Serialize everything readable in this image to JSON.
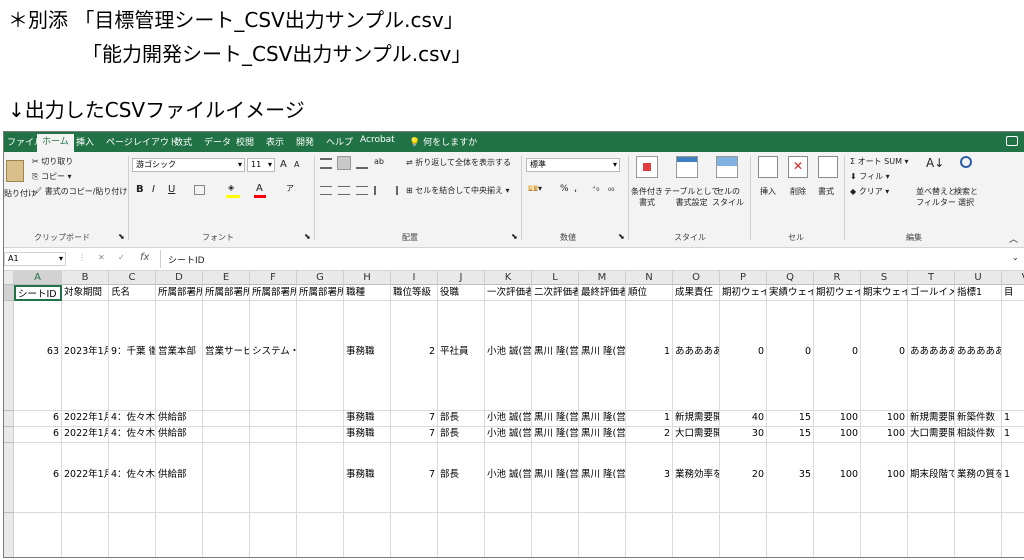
{
  "caption": {
    "line1_prefix": "＊別添",
    "line1_file": "「目標管理シート_CSV出力サンプル.csv」",
    "line2_file": "「能力開発シート_CSV出力サンプル.csv」",
    "line3": "↓出力したCSVファイルイメージ"
  },
  "colors": {
    "excel_green": "#217346",
    "ribbon_bg": "#f3f3f3"
  },
  "menu": {
    "tabs": [
      "ファイル",
      "ホーム",
      "挿入",
      "ページレイアウト",
      "数式",
      "データ",
      "校閲",
      "表示",
      "開発",
      "ヘルプ",
      "Acrobat"
    ],
    "active": "ホーム",
    "search_label": "何をしますか"
  },
  "ribbon": {
    "clipboard": {
      "cut": "切り取り",
      "copy": "コピー",
      "paste": "貼り付け",
      "format_painter": "書式のコピー/貼り付け",
      "group": "クリップボード"
    },
    "font": {
      "name": "游ゴシック",
      "size": "11",
      "grow": "A",
      "shrink": "A",
      "bold": "B",
      "italic": "I",
      "underline": "U",
      "color_a": "A",
      "phonetic": "ア",
      "group": "フォント"
    },
    "alignment": {
      "wrap": "折り返して全体を表示する",
      "merge": "セルを結合して中央揃え",
      "orient": "ab",
      "group": "配置"
    },
    "number": {
      "format": "標準",
      "percent": "%",
      "comma": ",",
      "group": "数値"
    },
    "styles": {
      "conditional": "条件付き\n書式",
      "table": "テーブルとして\n書式設定",
      "cell": "セルの\nスタイル",
      "group": "スタイル"
    },
    "cells": {
      "insert": "挿入",
      "delete": "削除",
      "format": "書式",
      "group": "セル"
    },
    "editing": {
      "sum": "オート SUM",
      "fill": "フィル",
      "clear": "クリア",
      "sort": "並べ替えと\nフィルター",
      "find": "検索と\n選択",
      "group": "編集"
    }
  },
  "formula_bar": {
    "name_box": "A1",
    "fx": "fx",
    "cancel": "✕",
    "enter": "✓",
    "content": "シートID"
  },
  "grid": {
    "columns": [
      "A",
      "B",
      "C",
      "D",
      "E",
      "F",
      "G",
      "H",
      "I",
      "J",
      "K",
      "L",
      "M",
      "N",
      "O",
      "P",
      "Q",
      "R",
      "S",
      "T",
      "U",
      "V"
    ],
    "header_row": [
      "シートID",
      "対象期間",
      "氏名",
      "所属部署所",
      "所属部署所",
      "所属部署所",
      "所属部署所",
      "職種",
      "職位等級",
      "役職",
      "一次評価者",
      "二次評価者",
      "最終評価者",
      "順位",
      "成果責任",
      "期初ウェイ",
      "実績ウェイ",
      "期初ウェイ",
      "期末ウェイ",
      "ゴールイメ",
      "指標1",
      "目"
    ],
    "rows": [
      [
        "63",
        "2023年1月",
        "9：千葉 徹",
        "営業本部",
        "営業サービ",
        "システム・",
        "",
        "事務職",
        "2",
        "平社員",
        "小池 誠(営",
        "黒川 隆(営",
        "黒川 隆(営",
        "1",
        "あああああ",
        "0",
        "0",
        "0",
        "0",
        "あああああ",
        "あああああ",
        ""
      ],
      [
        "6",
        "2022年1月",
        "4：佐々木",
        "供給部",
        "",
        "",
        "",
        "事務職",
        "7",
        "部長",
        "小池 誠(営",
        "黒川 隆(営",
        "黒川 隆(営",
        "1",
        "新規需要開",
        "40",
        "15",
        "100",
        "100",
        "新規需要開",
        "新築件数",
        "1"
      ],
      [
        "6",
        "2022年1月",
        "4：佐々木",
        "供給部",
        "",
        "",
        "",
        "事務職",
        "7",
        "部長",
        "小池 誠(営",
        "黒川 隆(営",
        "黒川 隆(営",
        "2",
        "大口需要開",
        "30",
        "15",
        "100",
        "100",
        "大口需要開",
        "相談件数",
        "1"
      ],
      [
        "6",
        "2022年1月",
        "4：佐々木",
        "供給部",
        "",
        "",
        "",
        "事務職",
        "7",
        "部長",
        "小池 誠(営",
        "黒川 隆(営",
        "黒川 隆(営",
        "3",
        "業務効率を",
        "20",
        "35",
        "100",
        "100",
        "期末段階で",
        "業務の質を",
        "1"
      ]
    ]
  }
}
